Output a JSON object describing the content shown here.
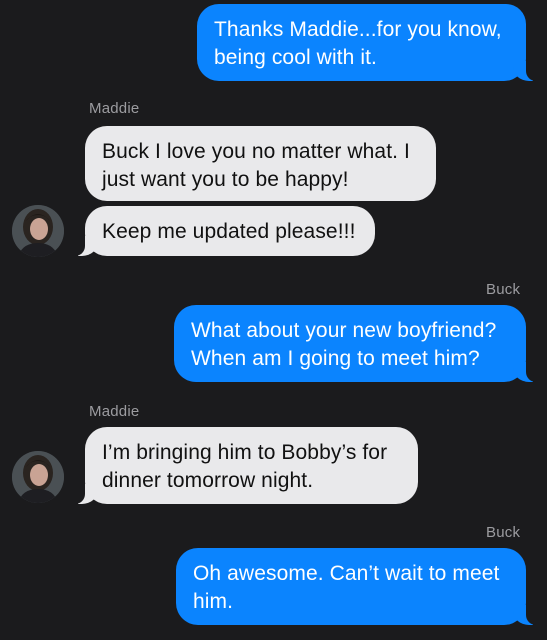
{
  "conversation": {
    "messages": [
      {
        "sender": "Buck",
        "direction": "outgoing",
        "text": "Thanks Maddie...for you know, being cool with it."
      },
      {
        "sender": "Maddie",
        "direction": "incoming",
        "text": "Buck I love you no matter what. I just want you to be happy!"
      },
      {
        "sender": "Maddie",
        "direction": "incoming",
        "text": "Keep me updated please!!!"
      },
      {
        "sender": "Buck",
        "direction": "outgoing",
        "text": "What about your new boyfriend? When am I going to meet him?"
      },
      {
        "sender": "Maddie",
        "direction": "incoming",
        "text": "I’m bringing him to Bobby’s for dinner tomorrow night."
      },
      {
        "sender": "Buck",
        "direction": "outgoing",
        "text": "Oh awesome. Can’t wait to meet him."
      }
    ],
    "sender_labels": {
      "maddie_1": "Maddie",
      "buck_1": "Buck",
      "maddie_2": "Maddie",
      "buck_2": "Buck"
    }
  },
  "colors": {
    "background": "#1b1b1d",
    "outgoing_bubble": "#0b84fe",
    "incoming_bubble": "#e9e9eb",
    "sender_label": "#9c9ca0"
  }
}
